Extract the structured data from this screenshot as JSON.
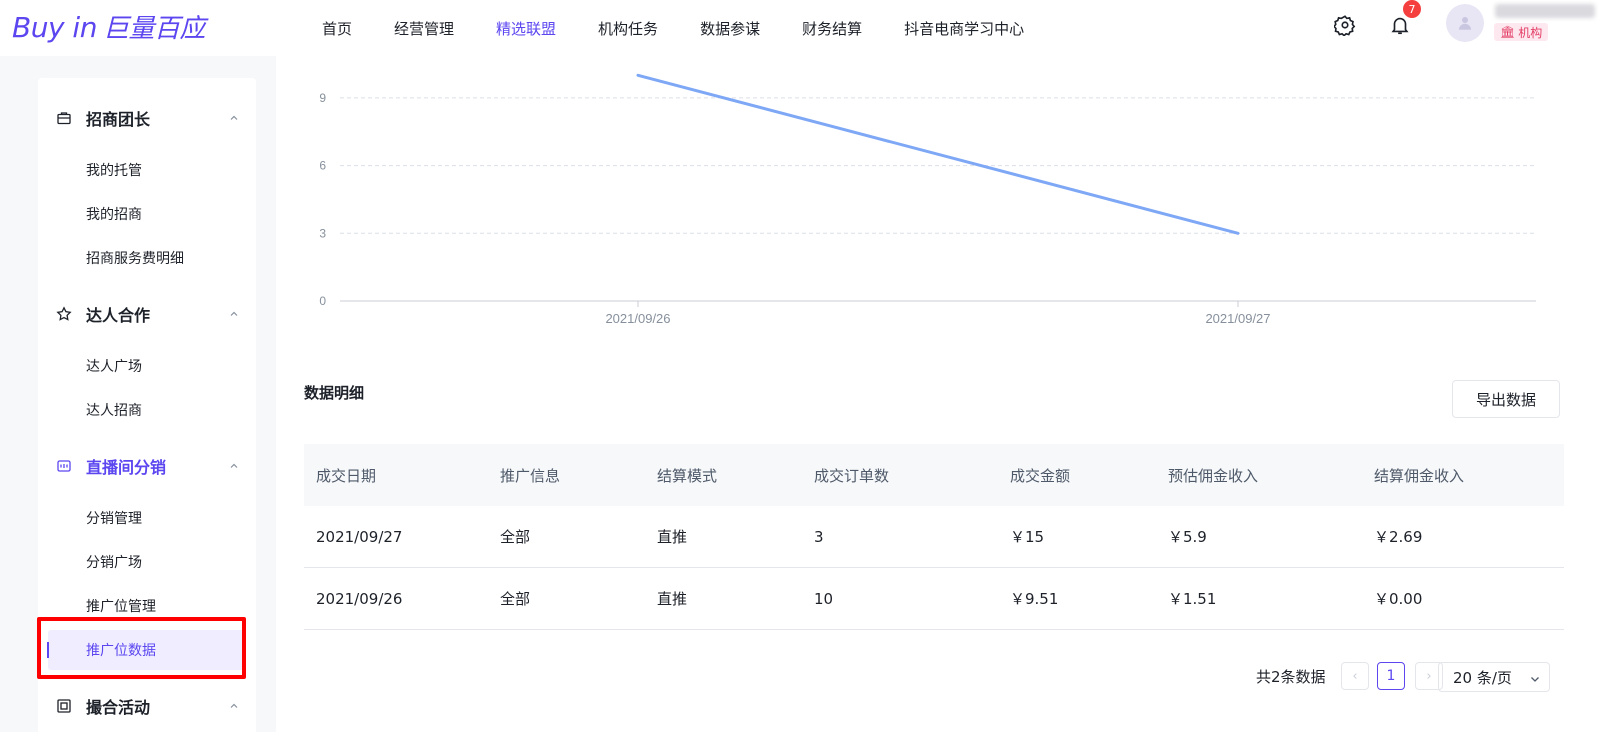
{
  "header": {
    "logo_text": "Buy in",
    "logo_sub": "巨量百应",
    "nav": [
      "首页",
      "经营管理",
      "精选联盟",
      "机构任务",
      "数据参谋",
      "财务结算",
      "抖音电商学习中心"
    ],
    "active_nav": "精选联盟",
    "notification_count": "7",
    "org_label": "机构"
  },
  "sidebar": {
    "groups": [
      {
        "label": "招商团长",
        "items": [
          "我的托管",
          "我的招商",
          "招商服务费明细"
        ]
      },
      {
        "label": "达人合作",
        "items": [
          "达人广场",
          "达人招商"
        ]
      },
      {
        "label": "直播间分销",
        "items": [
          "分销管理",
          "分销广场",
          "推广位管理",
          "推广位数据"
        ]
      },
      {
        "label": "撮合活动",
        "items": []
      }
    ],
    "active_item": "推广位数据"
  },
  "chart_data": {
    "type": "line",
    "categories": [
      "2021/09/26",
      "2021/09/27"
    ],
    "series": [
      {
        "values": [
          10,
          3
        ]
      }
    ],
    "yticks": [
      0,
      3,
      6,
      9
    ],
    "ylim": [
      0,
      10.5
    ],
    "grid": true,
    "colors": {
      "line": "#7ea8f5",
      "grid": "#dcdfe6"
    }
  },
  "detail": {
    "title": "数据明细",
    "export_label": "导出数据",
    "columns": [
      "成交日期",
      "推广信息",
      "结算模式",
      "成交订单数",
      "成交金额",
      "预估佣金收入",
      "结算佣金收入"
    ],
    "rows": [
      [
        "2021/09/27",
        "全部",
        "直推",
        "3",
        "￥15",
        "￥5.9",
        "￥2.69"
      ],
      [
        "2021/09/26",
        "全部",
        "直推",
        "10",
        "￥9.51",
        "￥1.51",
        "￥0.00"
      ]
    ]
  },
  "pagination": {
    "total_text": "共2条数据",
    "current_page": "1",
    "prev": "‹",
    "next": "›",
    "page_size": "20 条/页"
  },
  "accent_color": "#5b46f0"
}
